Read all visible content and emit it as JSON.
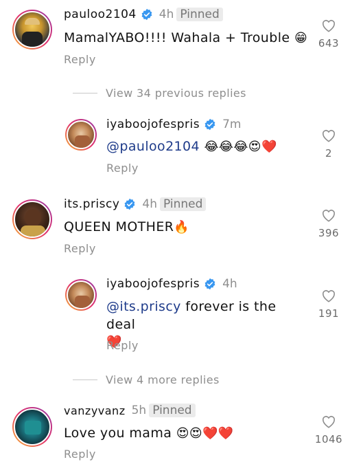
{
  "comments": [
    {
      "username": "pauloo2104",
      "time": "4h",
      "pinned": "Pinned",
      "text": "MamalYABO!!!! Wahala + Trouble",
      "emoji": "😁",
      "reply": "Reply",
      "likes": "643"
    },
    {
      "username": "iyaboojofespris",
      "time": "7m",
      "mention": "@pauloo2104",
      "text": "",
      "emoji": "😂😂😂😍❤️",
      "reply": "Reply",
      "likes": "2"
    },
    {
      "username": "its.priscy",
      "time": "4h",
      "pinned": "Pinned",
      "text": "QUEEN MOTHER",
      "emoji": "🔥",
      "reply": "Reply",
      "likes": "396"
    },
    {
      "username": "iyaboojofespris",
      "time": "4h",
      "mention": "@its.priscy",
      "text": " forever is the deal",
      "emoji": "❤️",
      "reply": "Reply",
      "likes": "191"
    },
    {
      "username": "vanzyvanz",
      "time": "5h",
      "pinned": "Pinned",
      "text": "Love you mama",
      "emoji": "😍😍❤️❤️",
      "reply": "Reply",
      "likes": "1046"
    }
  ],
  "view_previous": "View 34 previous replies",
  "view_more": "View 4 more replies",
  "colors": {
    "verified": "#3897f0",
    "mention": "#1e3b8a",
    "muted": "#8e8e8e"
  },
  "icons": {
    "verified": "verified-badge-icon",
    "like": "heart-outline-icon"
  }
}
